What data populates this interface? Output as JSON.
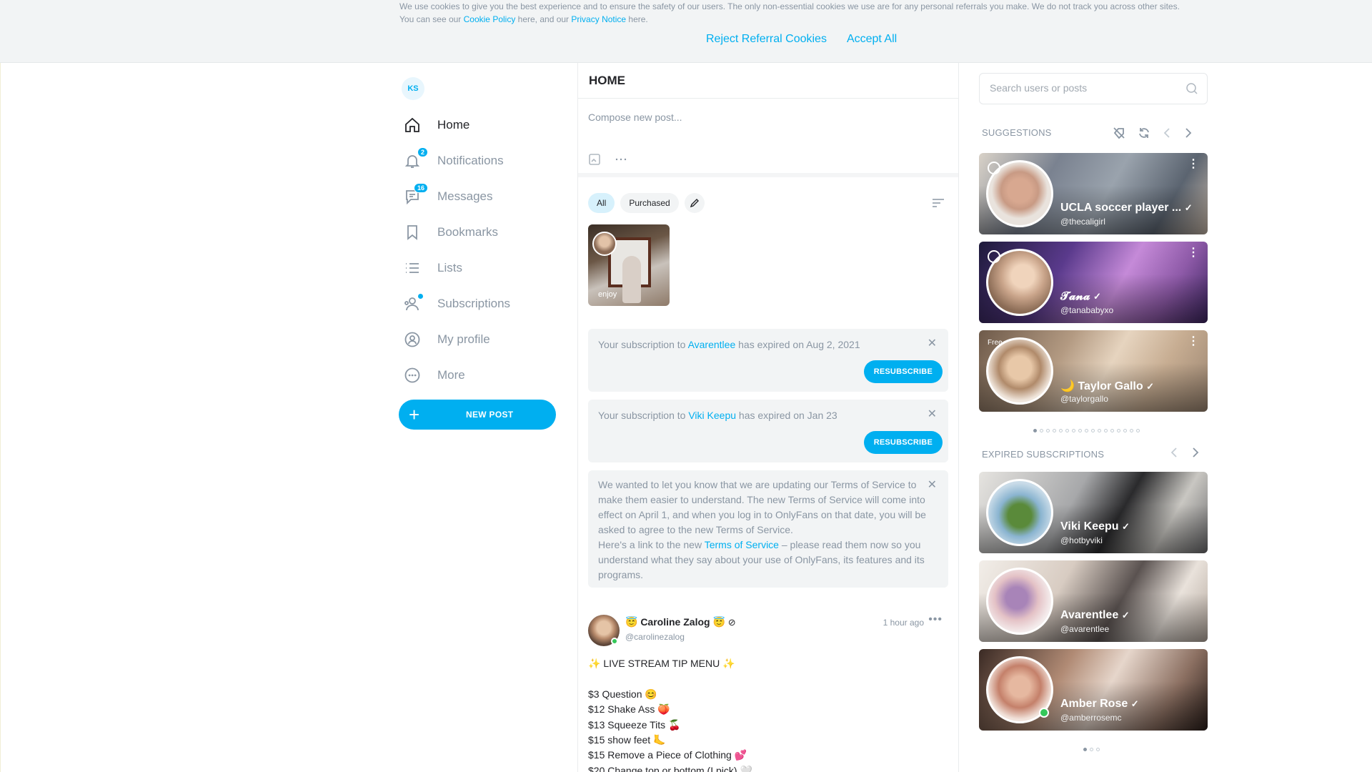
{
  "cookie": {
    "line1": "We use cookies to give you the best experience and to ensure the safety of our users. The only non-essential cookies we use are for any personal referrals you make. We do not track you across other sites.",
    "line2_pre": "You can see our ",
    "cookie_policy": "Cookie Policy",
    "line2_mid": " here, and our ",
    "privacy_notice": "Privacy Notice",
    "line2_post": " here.",
    "reject": "Reject Referral Cookies",
    "accept": "Accept All"
  },
  "nav": {
    "avatar_initials": "KS",
    "items": [
      {
        "label": "Home",
        "icon": "home-icon"
      },
      {
        "label": "Notifications",
        "icon": "bell-icon",
        "badge": "2"
      },
      {
        "label": "Messages",
        "icon": "chat-icon",
        "badge": "16"
      },
      {
        "label": "Bookmarks",
        "icon": "bookmark-icon"
      },
      {
        "label": "Lists",
        "icon": "list-icon"
      },
      {
        "label": "Subscriptions",
        "icon": "users-icon"
      },
      {
        "label": "My profile",
        "icon": "profile-icon"
      },
      {
        "label": "More",
        "icon": "more-icon"
      }
    ],
    "new_post": "NEW POST"
  },
  "feed": {
    "title": "HOME",
    "compose_placeholder": "Compose new post...",
    "filters": {
      "all": "All",
      "purchased": "Purchased"
    },
    "story_label": "enjoy",
    "notices": [
      {
        "pre": "Your subscription to ",
        "name": "Avarentlee",
        "post": " has expired on Aug 2, 2021",
        "button": "RESUBSCRIBE"
      },
      {
        "pre": "Your subscription to ",
        "name": "Viki Keepu",
        "post": " has expired on Jan 23",
        "button": "RESUBSCRIBE"
      }
    ],
    "tos": {
      "text1": "We wanted to let you know that we are updating our Terms of Service to make them easier to understand. The new Terms of Service will come into effect on April 1, and when you log in to OnlyFans on that date, you will be asked to agree to the new Terms of Service.",
      "text2_pre": "Here's a link to the new ",
      "link": "Terms of Service",
      "text2_post": " – please read them now so you understand what they say about your use of OnlyFans, its features and its programs."
    },
    "post": {
      "name": "😇 Caroline Zalog 😇",
      "handle": "@carolinezalog",
      "time": "1 hour ago",
      "body": "✨ LIVE STREAM TIP MENU ✨\n\n$3 Question 😊\n$12 Shake Ass 🍑\n$13 Squeeze Tits 🍒\n$15 show feet 🦶\n$15 Remove a Piece of Clothing 💕\n$20 Change top or bottom (I pick) 🤍"
    }
  },
  "sidebar": {
    "search_placeholder": "Search users or posts",
    "suggestions_title": "SUGGESTIONS",
    "expired_title": "EXPIRED SUBSCRIPTIONS",
    "suggestions": [
      {
        "name": "UCLA soccer player ...",
        "handle": "@thecaligirl"
      },
      {
        "name": "𝓣𝓪𝓷𝓪",
        "handle": "@tanababyxo"
      },
      {
        "name": "🌙 Taylor Gallo",
        "handle": "@taylorgallo",
        "tag": "Free"
      }
    ],
    "expired": [
      {
        "name": "Viki Keepu",
        "handle": "@hotbyviki"
      },
      {
        "name": "Avarentlee",
        "handle": "@avarentlee"
      },
      {
        "name": "Amber Rose",
        "handle": "@amberrosemc"
      }
    ]
  },
  "colors": {
    "accent": "#00aff0",
    "muted": "#8a96a3",
    "online": "#34c759"
  }
}
